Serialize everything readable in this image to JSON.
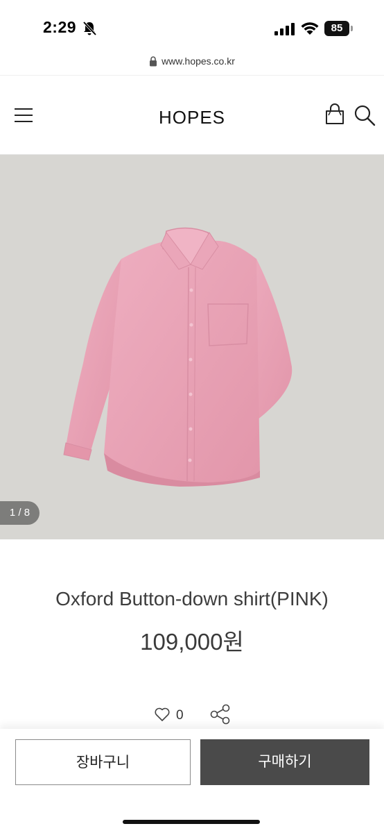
{
  "status_bar": {
    "time": "2:29",
    "battery": "85"
  },
  "browser": {
    "url": "www.hopes.co.kr"
  },
  "header": {
    "brand": "HOPES"
  },
  "gallery": {
    "counter": "1 / 8"
  },
  "product": {
    "name": "Oxford Button-down shirt(PINK)",
    "price": "109,000원",
    "like_count": "0"
  },
  "bottom_bar": {
    "cart_label": "장바구니",
    "buy_label": "구매하기"
  },
  "colors": {
    "image_background": "#d7d6d2",
    "shirt": "#e8a2b4",
    "buy_button": "#4a4a4a"
  },
  "icons": [
    "bell-off-icon",
    "signal-icon",
    "wifi-icon",
    "battery-icon",
    "lock-icon",
    "menu-icon",
    "shopping-bag-icon",
    "search-icon",
    "heart-icon",
    "share-icon"
  ]
}
